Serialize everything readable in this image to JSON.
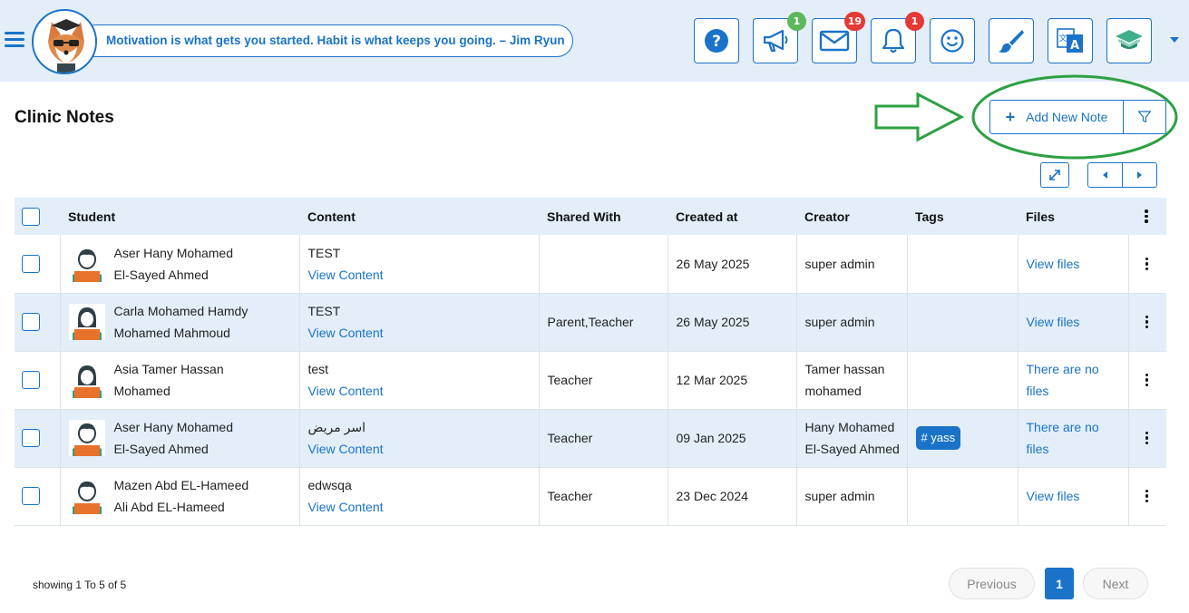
{
  "header": {
    "quote": "Motivation is what gets you started. Habit is what keeps you going. – Jim Ryun",
    "badges": {
      "announcements": "1",
      "messages": "19",
      "notifications": "1"
    }
  },
  "page": {
    "title": "Clinic Notes",
    "add_label": "Add New Note"
  },
  "table": {
    "columns": {
      "student": "Student",
      "content": "Content",
      "shared": "Shared With",
      "created": "Created at",
      "creator": "Creator",
      "tags": "Tags",
      "files": "Files"
    },
    "rows": [
      {
        "student_line1": "Aser Hany Mohamed",
        "student_line2": "El-Sayed Ahmed",
        "content": "TEST",
        "content_link": "View Content",
        "shared": "",
        "created": "26 May 2025",
        "creator_line1": "super admin",
        "creator_line2": "",
        "tag": "",
        "files_line1": "View files",
        "files_line2": ""
      },
      {
        "student_line1": "Carla Mohamed Hamdy",
        "student_line2": "Mohamed Mahmoud",
        "content": "TEST",
        "content_link": "View Content",
        "shared": "Parent,Teacher",
        "created": "26 May 2025",
        "creator_line1": "super admin",
        "creator_line2": "",
        "tag": "",
        "files_line1": "View files",
        "files_line2": ""
      },
      {
        "student_line1": "Asia Tamer Hassan",
        "student_line2": "Mohamed",
        "content": "test",
        "content_link": "View Content",
        "shared": "Teacher",
        "created": "12 Mar 2025",
        "creator_line1": "Tamer hassan",
        "creator_line2": "mohamed",
        "tag": "",
        "files_line1": "There are no",
        "files_line2": "files"
      },
      {
        "student_line1": "Aser Hany Mohamed",
        "student_line2": "El-Sayed Ahmed",
        "content": "اسر مريض",
        "content_link": "View Content",
        "shared": "Teacher",
        "created": "09 Jan 2025",
        "creator_line1": "Hany Mohamed",
        "creator_line2": "El-Sayed Ahmed",
        "tag": "# yass",
        "files_line1": "There are no",
        "files_line2": "files"
      },
      {
        "student_line1": "Mazen Abd EL-Hameed",
        "student_line2": "Ali Abd EL-Hameed",
        "content": "edwsqa",
        "content_link": "View Content",
        "shared": "Teacher",
        "created": "23 Dec 2024",
        "creator_line1": "super admin",
        "creator_line2": "",
        "tag": "",
        "files_line1": "View files",
        "files_line2": ""
      }
    ]
  },
  "footer": {
    "showing": "showing 1 To 5 of 5",
    "previous": "Previous",
    "current_page": "1",
    "next": "Next"
  },
  "colors": {
    "accent": "#1a73c8",
    "header_bg": "#e3eef9",
    "annotation": "#2ea043",
    "badge_green": "#5cb85c",
    "badge_red": "#e53935"
  }
}
